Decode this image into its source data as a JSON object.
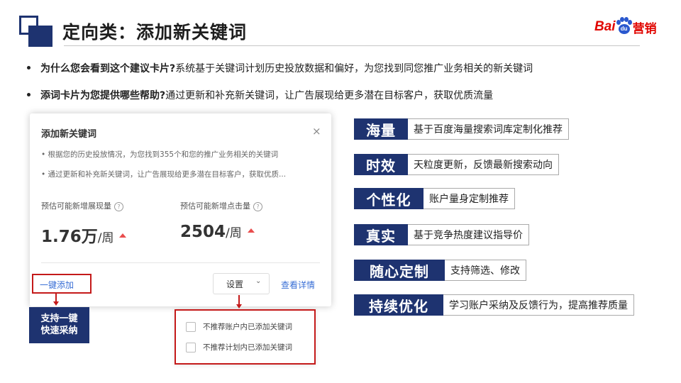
{
  "header": {
    "title": "定向类：添加新关键词",
    "logo": {
      "left": "Bai",
      "paw": "du",
      "right": "营销"
    }
  },
  "bullets": [
    {
      "bold": "为什么您会看到这个建议卡片?",
      "text": "系统基于关键词计划历史投放数据和偏好，为您找到同您推广业务相关的新关键词"
    },
    {
      "bold": "添词卡片为您提供哪些帮助?",
      "text": "通过更新和补充新关键词，让广告展现给更多潜在目标客户，获取优质流量"
    }
  ],
  "card": {
    "title": "添加新关键词",
    "close": "×",
    "desc": [
      "• 根据您的历史投放情况，为您找到355个和您的推广业务相关的关键词",
      "• 通过更新和补充新关键词，让广告展现给更多潜在目标客户，获取优质..."
    ],
    "stats": [
      {
        "label": "预估可能新增展现量",
        "value": "1.76万",
        "unit": "/周"
      },
      {
        "label": "预估可能新增点击量",
        "value": "2504",
        "unit": "/周"
      }
    ],
    "help_icon": "?",
    "one_click": "一键添加",
    "settings": "设置",
    "settings_chevron": "⌄",
    "details": "查看详情"
  },
  "callout": {
    "line1": "支持一键",
    "line2": "快速采纳"
  },
  "popup": {
    "options": [
      {
        "label": "不推荐账户内已添加关键词",
        "checked": false
      },
      {
        "label": "不推荐计划内已添加关键词",
        "checked": false
      }
    ]
  },
  "features": [
    {
      "tag": "海量",
      "desc": "基于百度海量搜索词库定制化推荐"
    },
    {
      "tag": "时效",
      "desc": "天粒度更新，反馈最新搜索动向"
    },
    {
      "tag": "个性化",
      "desc": "账户量身定制推荐"
    },
    {
      "tag": "真实",
      "desc": "基于竞争热度建议指导价"
    },
    {
      "tag": "随心定制",
      "desc": "支持筛选、修改"
    },
    {
      "tag": "持续优化",
      "desc": "学习账户采纳及反馈行为，提高推荐质量"
    }
  ],
  "colors": {
    "navy": "#1e3370",
    "red": "#c41a1a",
    "link": "#3a6fd6",
    "brand_red": "#e10601",
    "brand_blue": "#2a58ce"
  }
}
